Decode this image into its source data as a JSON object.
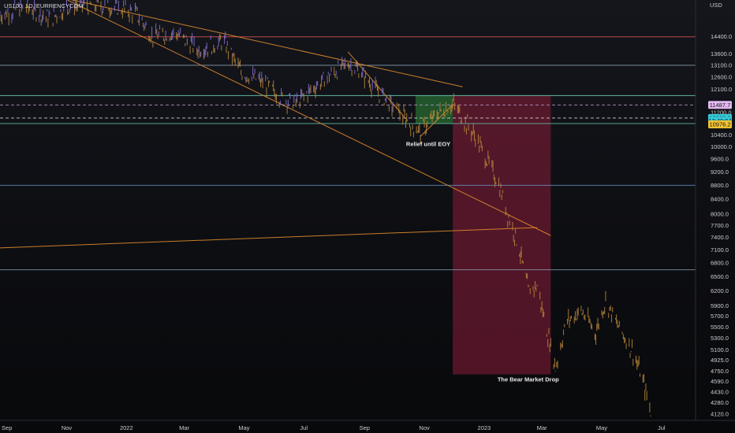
{
  "header": {
    "symbol": "US100, 1D, EURRENCYCOM",
    "currency": "USD"
  },
  "price_tags": [
    {
      "label": "11487.7",
      "value": 11487.7,
      "bg": "#e3b8f0",
      "fg": "#1a1a1a"
    },
    {
      "label": "10998.2",
      "value": 11000,
      "bg": "#36c9d6",
      "fg": "#08262a"
    },
    {
      "label": "13:49:04",
      "value": 10900,
      "bg": "#36c9d6",
      "fg": "#08262a"
    },
    {
      "label": "10976.2",
      "value": 10770,
      "bg": "#f2c230",
      "fg": "#1a1a1a"
    }
  ],
  "chart_data": {
    "type": "line",
    "title": "",
    "y_scale": "log",
    "ylim": [
      4120,
      16100
    ],
    "y_ticks": [
      14400,
      13600,
      13100,
      12600,
      12100,
      11200,
      10400,
      10000,
      9600,
      9200,
      8800,
      8400,
      8000,
      7700,
      7400,
      7100,
      6800,
      6500,
      6200,
      5900,
      5700,
      5500,
      5300,
      5100,
      4925,
      4750,
      4590,
      4430,
      4280,
      4120
    ],
    "y_tick_labels": [
      "14400.0",
      "13600.0",
      "13100.0",
      "12600.0",
      "12100.0",
      "11200.0",
      "10400.0",
      "10000.0",
      "9600.0",
      "9200.0",
      "8800.0",
      "8400.0",
      "8000.0",
      "7700.0",
      "7400.0",
      "7100.0",
      "6800.0",
      "6500.0",
      "6200.0",
      "5900.0",
      "5700.0",
      "5500.0",
      "5300.0",
      "5100.0",
      "4925.0",
      "4750.0",
      "4590.0",
      "4430.0",
      "4280.0",
      "4120.0"
    ],
    "x_labels": [
      "Sep",
      "Nov",
      "2022",
      "Mar",
      "May",
      "Jul",
      "Sep",
      "Nov",
      "2023",
      "Mar",
      "May",
      "Jul"
    ],
    "x_label_dates": [
      "2021-09-01",
      "2021-11-01",
      "2022-01-01",
      "2022-03-01",
      "2022-05-01",
      "2022-07-01",
      "2022-09-01",
      "2022-11-01",
      "2023-01-01",
      "2023-03-01",
      "2023-05-01",
      "2023-07-01"
    ],
    "series": [
      {
        "color_up": "#8a73d9",
        "color_down": "#c08b3c",
        "dates": [
          "2021-08-25",
          "2021-09-20",
          "2021-10-15",
          "2021-11-05",
          "2021-11-25",
          "2021-12-20",
          "2022-01-10",
          "2022-01-28",
          "2022-02-20",
          "2022-03-15",
          "2022-04-10",
          "2022-04-28",
          "2022-05-20",
          "2022-06-10",
          "2022-06-25",
          "2022-07-12",
          "2022-07-28",
          "2022-08-16",
          "2022-08-26",
          "2022-09-10",
          "2022-09-30",
          "2022-10-15",
          "2022-10-28",
          "2022-11-15",
          "2022-12-01",
          "2022-12-10",
          "2022-12-22",
          "2023-01-05",
          "2023-01-15",
          "2023-01-25",
          "2023-02-05",
          "2023-02-15",
          "2023-02-24",
          "2023-03-05",
          "2023-03-15",
          "2023-03-26",
          "2023-04-10",
          "2023-04-25",
          "2023-05-05",
          "2023-05-18",
          "2023-06-01",
          "2023-06-10",
          "2023-06-20"
        ],
        "values": [
          15500,
          15900,
          15300,
          16000,
          16000,
          15900,
          15600,
          14400,
          14600,
          13800,
          14200,
          12800,
          12400,
          11700,
          11600,
          12200,
          12700,
          13200,
          12900,
          12200,
          11400,
          10900,
          10500,
          11200,
          11500,
          11000,
          10400,
          9500,
          8900,
          8000,
          7200,
          6200,
          6300,
          5500,
          4800,
          5600,
          5800,
          5400,
          6000,
          5500,
          5100,
          4700,
          4150
        ]
      }
    ],
    "horizontal_levels": [
      {
        "value": 14400,
        "color": "#d9534f"
      },
      {
        "value": 13100,
        "color": "#9fb3cc"
      },
      {
        "value": 11850,
        "color": "#6fd3b8"
      },
      {
        "value": 11487.7,
        "color": "#c9a8d8",
        "style": "dashed"
      },
      {
        "value": 10998.2,
        "color": "#e6e6e6",
        "style": "dashed"
      },
      {
        "value": 10800,
        "color": "#6fd3b8"
      },
      {
        "value": 8800,
        "color": "#6fa0d8"
      },
      {
        "value": 6650,
        "color": "#8fa6bd"
      }
    ],
    "annotations": [
      {
        "text": "Relief until EOY",
        "date": "2022-11-05",
        "value": 10020
      },
      {
        "text": "The Bear Market Drop",
        "date": "2023-02-15",
        "value": 4590
      }
    ]
  }
}
